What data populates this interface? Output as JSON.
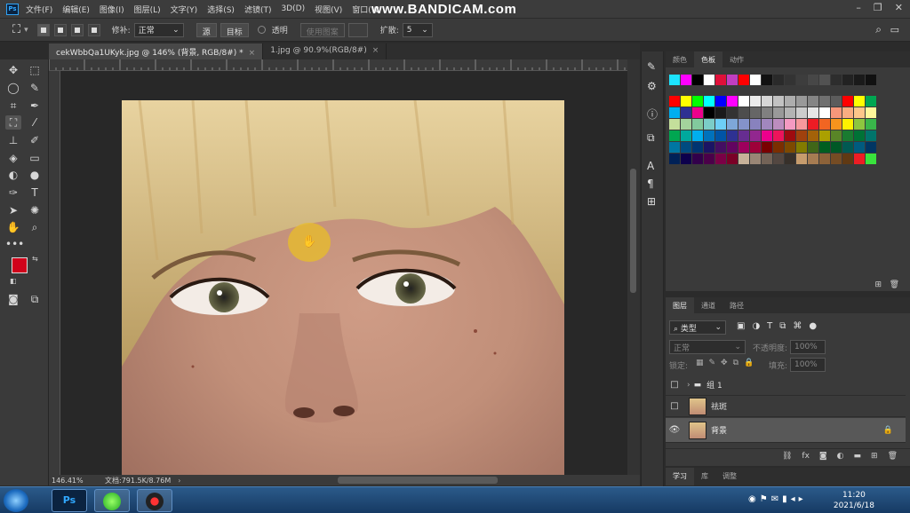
{
  "menubar": {
    "logo": "Ps",
    "items": [
      "文件(F)",
      "编辑(E)",
      "图像(I)",
      "图层(L)",
      "文字(Y)",
      "选择(S)",
      "滤镜(T)",
      "3D(D)",
      "视图(V)",
      "窗口(W"
    ],
    "watermark": "www.BANDICAM.com"
  },
  "options": {
    "feather_label": "修补:",
    "mode_value": "正常",
    "source": "源",
    "target": "目标",
    "transparent": "透明",
    "use_pattern": "使用图案",
    "diffusion_label": "扩散:",
    "diffusion_value": "5"
  },
  "tabs": [
    {
      "label": "cekWbbQa1UKyk.jpg @ 146% (背景, RGB/8#) *",
      "active": true
    },
    {
      "label": "1.jpg @ 90.9%(RGB/8#)",
      "active": false
    }
  ],
  "status": {
    "zoom": "146.41%",
    "doc": "文档:791.5K/8.76M"
  },
  "swatches": {
    "tabs": [
      "颜色",
      "色板",
      "动作"
    ],
    "active": "色板",
    "recent": [
      "#1de4ff",
      "#ff00ff",
      "#000000",
      "#ffffff",
      "#e0103a",
      "#c23ec0",
      "#ff0000",
      "#ffffff",
      "#111111",
      "#2a2a2a",
      "#333333",
      "#3d3d3d",
      "#474747",
      "#525252",
      "#2d2d2d",
      "#222222",
      "#1a1a1a",
      "#111111"
    ],
    "rows": [
      [
        "#ff0000",
        "#ffff00",
        "#00ff00",
        "#00ffff",
        "#0000ff",
        "#ff00ff",
        "#ffffff",
        "#ebebeb",
        "#d6d6d6",
        "#c2c2c2",
        "#adadad",
        "#999999",
        "#858585",
        "#707070",
        "#5c5c5c",
        "#ff0000",
        "#ffff00",
        "#00a651"
      ],
      [
        "#00aeef",
        "#2e3192",
        "#ec008c",
        "#000000",
        "#1a1a1a",
        "#333333",
        "#4d4d4d",
        "#666666",
        "#808080",
        "#999999",
        "#b3b3b3",
        "#cccccc",
        "#e6e6e6",
        "#ffffff",
        "#f7977a",
        "#f9ad81",
        "#fdc68a",
        "#fff79a"
      ],
      [
        "#c4df9b",
        "#a3d39c",
        "#82ca9d",
        "#7bcdc8",
        "#6ecff6",
        "#7ea7d8",
        "#8493ca",
        "#8882be",
        "#a187be",
        "#bc8dbf",
        "#f49ac2",
        "#f6989d",
        "#ed1c24",
        "#f26522",
        "#f7941d",
        "#fff200",
        "#8dc63f",
        "#39b54a"
      ],
      [
        "#00a651",
        "#00a99d",
        "#00aeef",
        "#0072bc",
        "#0054a6",
        "#2e3192",
        "#662d91",
        "#92278f",
        "#ec008c",
        "#ed145b",
        "#9e0b0f",
        "#a0410d",
        "#a36209",
        "#aba000",
        "#598527",
        "#1a7b30",
        "#007236",
        "#00746b"
      ],
      [
        "#0076a3",
        "#004b80",
        "#003471",
        "#1b1464",
        "#440e62",
        "#630460",
        "#9e005d",
        "#9e0039",
        "#790000",
        "#7b2e00",
        "#7d4900",
        "#827b00",
        "#406618",
        "#005e20",
        "#005826",
        "#005952",
        "#005b7f",
        "#003663"
      ],
      [
        "#002157",
        "#0d004c",
        "#32004b",
        "#4b0049",
        "#7b0046",
        "#7a0026",
        "#c7b299",
        "#998675",
        "#736357",
        "#534741",
        "#37302a",
        "#c69c6d",
        "#a67c52",
        "#8c6239",
        "#754c24",
        "#603913",
        "#ee1d24",
        "#39e33d"
      ]
    ]
  },
  "layers_panel": {
    "tabs": [
      "图层",
      "通道",
      "路径"
    ],
    "active": "图层",
    "filter": "类型",
    "blend": "正常",
    "opacity_label": "不透明度:",
    "opacity": "100%",
    "lock_label": "锁定:",
    "fill_label": "填充:",
    "fill": "100%",
    "layers": [
      {
        "name": "组 1",
        "type": "group",
        "visible": false
      },
      {
        "name": "祛斑",
        "type": "image",
        "visible": false
      },
      {
        "name": "背景",
        "type": "image",
        "visible": true,
        "active": true,
        "locked": true
      }
    ]
  },
  "learn_tabs": [
    "学习",
    "库",
    "调整"
  ],
  "taskbar": {
    "time": "11:20",
    "date": "2021/6/18"
  }
}
